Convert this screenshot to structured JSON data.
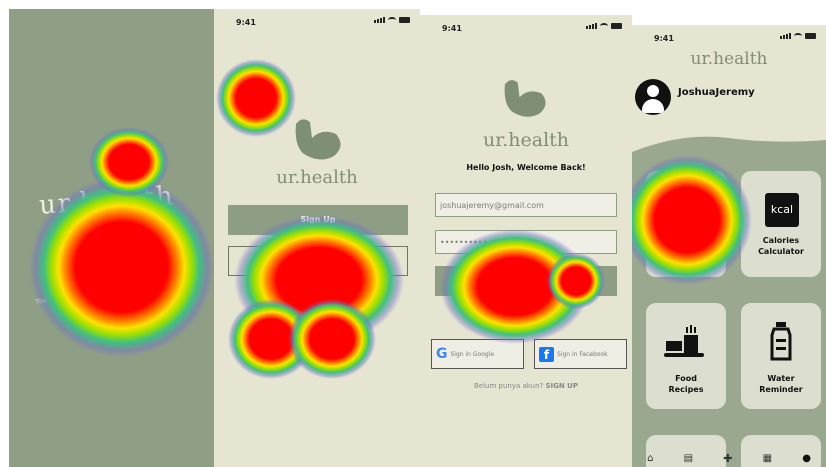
{
  "splash": {
    "brand": "ur.health",
    "tagline": "The healthiest version of you, always"
  },
  "signup": {
    "time": "9:41",
    "brand": "ur.health",
    "signup_label": "Sign Up"
  },
  "login": {
    "time": "9:41",
    "brand": "ur.health",
    "welcome": "Hello Josh, Welcome Back!",
    "email_value": "joshuajeremy@gmail.com",
    "password_value": "••••••••••",
    "google_label": "Sign in Google",
    "facebook_label": "Sign in Facebook",
    "no_account": "Belum punya akun?",
    "signup_link": "SIGN UP"
  },
  "home": {
    "time": "9:41",
    "brand": "ur.health",
    "username": "JoshuaJeremy",
    "cards": [
      {
        "label": "Calories\nCalculator",
        "icon": "kcal-icon",
        "icon_text": "kcal"
      },
      {
        "label": "Food\nRecipes",
        "icon": "food-icon"
      },
      {
        "label": "Water\nReminder",
        "icon": "water-bottle-icon"
      }
    ],
    "nav": [
      "home-icon",
      "clipboard-icon",
      "add-icon",
      "calendar-icon",
      "profile-icon"
    ]
  },
  "colors": {
    "sage": "#8e9e85",
    "cream": "#e6e5d2",
    "card": "#dcdfcf",
    "heat_core": "#ff0000"
  }
}
